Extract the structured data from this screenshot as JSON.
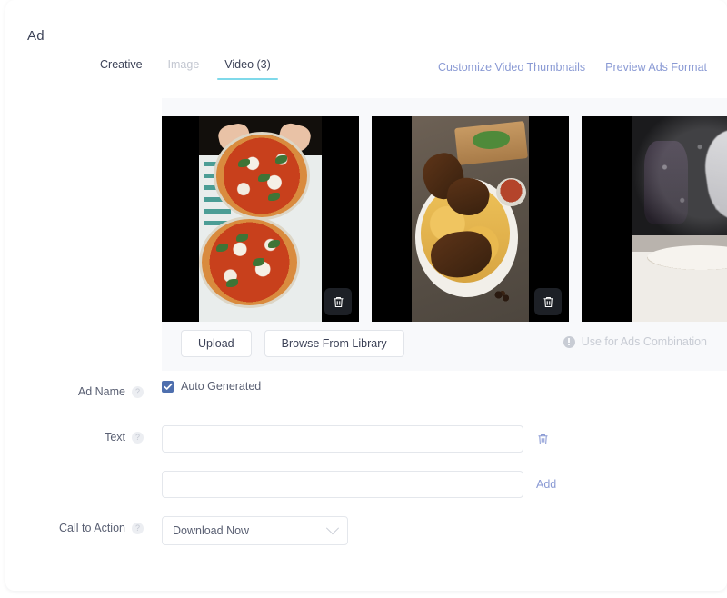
{
  "page": {
    "title": "Ad"
  },
  "tabs": [
    {
      "label": "Creative",
      "state": "normal"
    },
    {
      "label": "Image",
      "state": "muted"
    },
    {
      "label": "Video (3)",
      "state": "active"
    }
  ],
  "header_links": [
    {
      "label": "Customize Video Thumbnails"
    },
    {
      "label": "Preview Ads Format"
    }
  ],
  "gallery": {
    "thumbnails": [
      {
        "alt": "Two margherita pizzas on a table with hands slicing",
        "delete_icon": "trash-icon"
      },
      {
        "alt": "Plate of biryani rice with roasted chicken pieces",
        "delete_icon": "trash-icon"
      },
      {
        "alt": "Hands dusting flour over pizza dough",
        "delete_icon": "trash-icon"
      }
    ],
    "buttons": [
      {
        "label": "Upload"
      },
      {
        "label": "Browse From Library"
      }
    ],
    "combination": {
      "label": "Use for Ads Combination",
      "icon": "info-icon",
      "disabled": true
    }
  },
  "form": {
    "ad_name": {
      "label": "Ad Name",
      "help_icon": "help-icon",
      "checkbox_label": "Auto Generated",
      "checked": true
    },
    "text": {
      "label": "Text",
      "help_icon": "help-icon",
      "value_1": "",
      "placeholder_1": "",
      "value_2": "",
      "placeholder_2": "",
      "delete_icon": "trash-icon",
      "add_label": "Add"
    },
    "call_to_action": {
      "label": "Call to Action",
      "help_icon": "help-icon",
      "value": "Download Now",
      "chevron_icon": "chevron-down-icon"
    }
  },
  "colors": {
    "accent_underline": "#7fd9ea",
    "link": "#8a9ad4",
    "checkbox": "#4e6fae",
    "text": "#3c4257",
    "muted": "#c3c7d1",
    "gallery_bg": "#f8f9fb"
  },
  "help_glyph": "?"
}
